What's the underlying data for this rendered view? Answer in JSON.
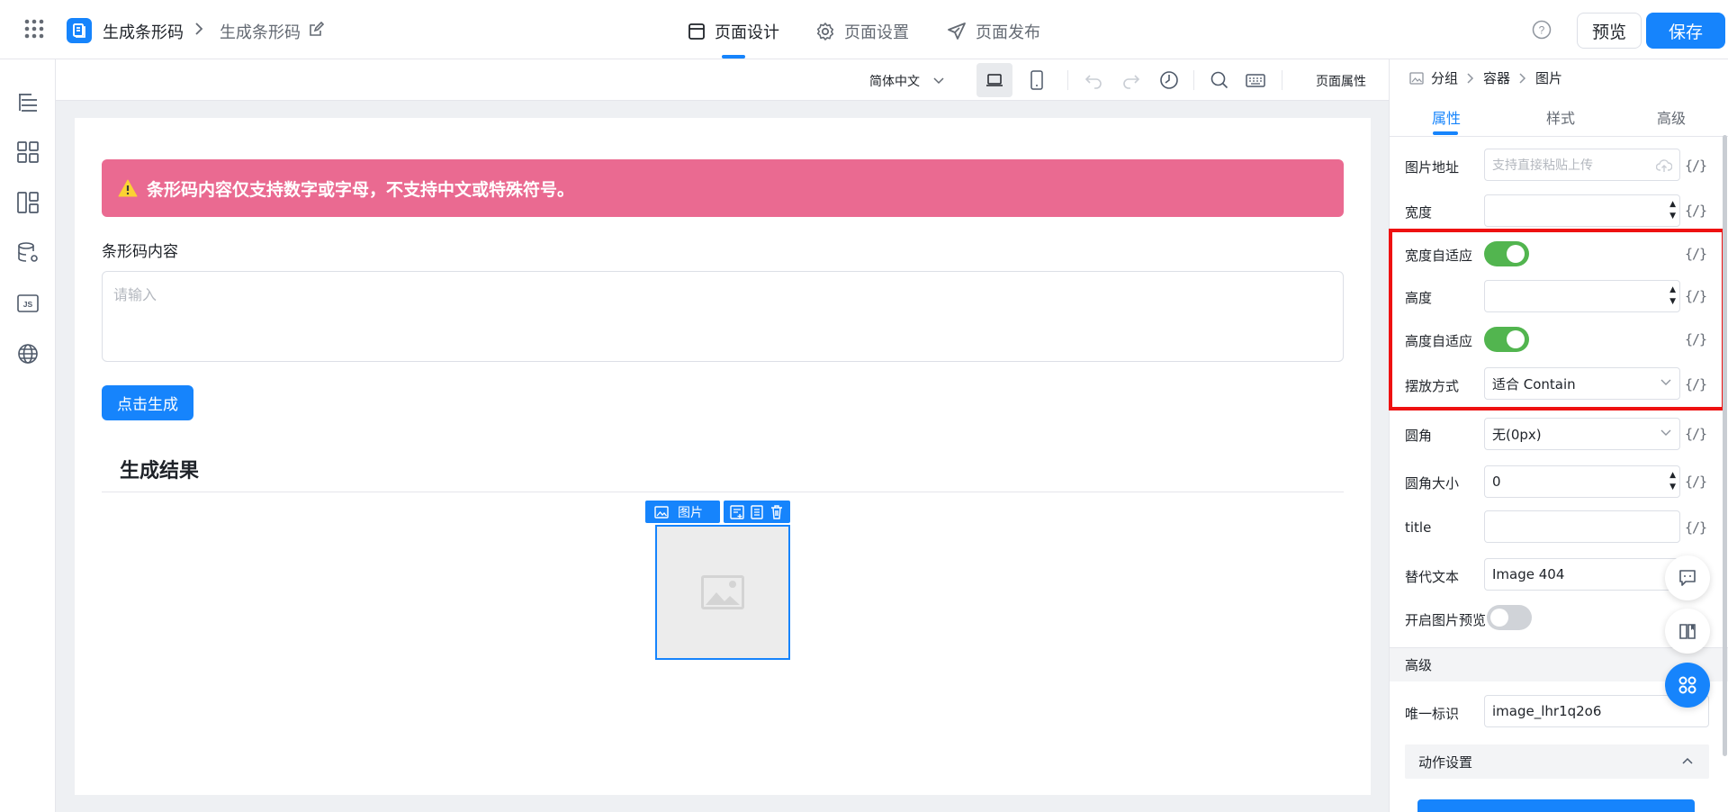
{
  "header": {
    "app_name": "生成条形码",
    "page_name": "生成条形码",
    "tabs": [
      {
        "label": "页面设计",
        "active": true
      },
      {
        "label": "页面设置",
        "active": false
      },
      {
        "label": "页面发布",
        "active": false
      }
    ],
    "preview_label": "预览",
    "save_label": "保存"
  },
  "toolbar": {
    "language": "简体中文",
    "page_props_label": "页面属性"
  },
  "canvas": {
    "alert_text": "条形码内容仅支持数字或字母，不支持中文或特殊符号。",
    "field_label": "条形码内容",
    "field_placeholder": "请输入",
    "generate_label": "点击生成",
    "result_title": "生成结果",
    "image_tag_label": "图片"
  },
  "properties": {
    "breadcrumb": [
      "分组",
      "容器",
      "图片"
    ],
    "tabs": [
      {
        "label": "属性",
        "active": true
      },
      {
        "label": "样式",
        "active": false
      },
      {
        "label": "高级",
        "active": false
      }
    ],
    "expr_label": "{/}",
    "image_url": {
      "label": "图片地址",
      "placeholder": "支持直接粘贴上传"
    },
    "width": {
      "label": "宽度",
      "value": ""
    },
    "width_auto": {
      "label": "宽度自适应",
      "on": true
    },
    "height": {
      "label": "高度",
      "value": ""
    },
    "height_auto": {
      "label": "高度自适应",
      "on": true
    },
    "fit": {
      "label": "摆放方式",
      "value": "适合 Contain"
    },
    "radius": {
      "label": "圆角",
      "value": "无(0px)"
    },
    "radius_size": {
      "label": "圆角大小",
      "value": "0"
    },
    "title": {
      "label": "title",
      "value": ""
    },
    "alt_text": {
      "label": "替代文本",
      "value": "Image 404"
    },
    "preview_toggle": {
      "label": "开启图片预览",
      "on": false
    },
    "advanced_section": "高级",
    "unique_id": {
      "label": "唯一标识",
      "value": "image_lhr1q2o6"
    },
    "action_section": "动作设置"
  },
  "colors": {
    "primary": "#1684fc",
    "alert": "#ea6a91",
    "toggle_on": "#52b54f",
    "highlight": "#ee1111"
  }
}
